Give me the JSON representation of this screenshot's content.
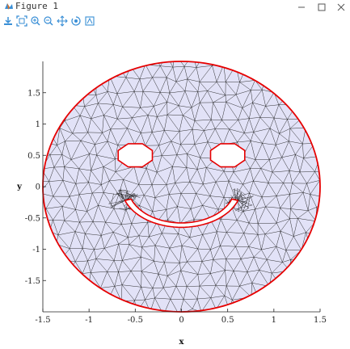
{
  "window": {
    "title": "Figure 1",
    "controls": [
      "minimize",
      "maximize",
      "close"
    ]
  },
  "toolbar": {
    "tools": [
      {
        "icon": "save-icon"
      },
      {
        "icon": "fit-view-icon"
      },
      {
        "icon": "zoom-in-icon"
      },
      {
        "icon": "zoom-out-icon"
      },
      {
        "icon": "pan-icon"
      },
      {
        "icon": "rotate-icon"
      },
      {
        "icon": "settings-icon"
      }
    ]
  },
  "colors": {
    "mesh_fill": "#e2e2f7",
    "mesh_edges": "#1a1a1a",
    "boundary": "#e60000",
    "toolbar_icon": "#3a8fd6"
  },
  "chart_data": {
    "type": "mesh",
    "title": "",
    "xlabel": "x",
    "ylabel": "y",
    "xlim": [
      -1.5,
      1.5
    ],
    "ylim": [
      -2.0,
      2.0
    ],
    "xticks": [
      -1.5,
      -1,
      -0.5,
      0,
      0.5,
      1,
      1.5
    ],
    "xtick_labels": [
      "-1.5",
      "-1",
      "-0.5",
      "0",
      "0.5",
      "1",
      "1.5"
    ],
    "yticks": [
      -1.5,
      -1,
      -0.5,
      0,
      0.5,
      1,
      1.5
    ],
    "ytick_labels": [
      "-1.5",
      "-1",
      "-0.5",
      "0",
      "0.5",
      "1",
      "1.5"
    ],
    "face": {
      "center": [
        0,
        0
      ],
      "rx": 1.5,
      "ry": 2.0
    },
    "eyes": [
      {
        "center": [
          -0.5,
          0.5
        ],
        "radius": 0.2,
        "sides": 8
      },
      {
        "center": [
          0.5,
          0.5
        ],
        "radius": 0.2,
        "sides": 8
      }
    ],
    "mouth": {
      "center": [
        0,
        0
      ],
      "outer_radius": 0.65,
      "inner_radius": 0.58,
      "angle_from_deg": 200,
      "angle_to_deg": 340
    }
  }
}
